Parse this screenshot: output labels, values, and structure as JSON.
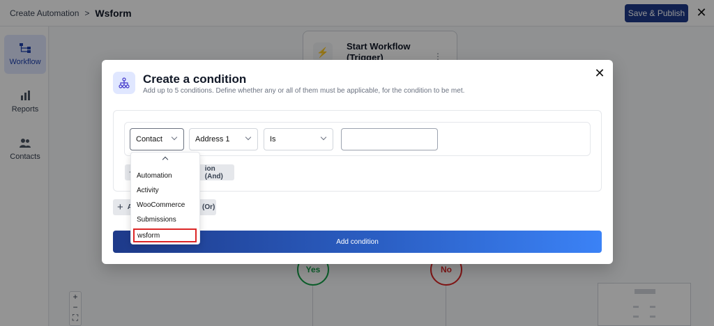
{
  "app": {
    "breadcrumb_root": "Create Automation",
    "breadcrumb_separator": ">",
    "breadcrumb_current": "Wsform",
    "save_publish_label": "Save & Publish",
    "close_glyph": "✕"
  },
  "sidebar": {
    "items": [
      {
        "label": "Workflow",
        "icon": "workflow-icon",
        "active": true
      },
      {
        "label": "Reports",
        "icon": "bar-chart-icon",
        "active": false
      },
      {
        "label": "Contacts",
        "icon": "users-icon",
        "active": false
      }
    ]
  },
  "canvas": {
    "trigger_title": "Start Workflow (Trigger)",
    "trigger_menu_glyph": "⋮",
    "branch_yes": "Yes",
    "branch_no": "No",
    "zoom_in": "+",
    "zoom_out": "−",
    "fit_glyph": "⛶"
  },
  "modal": {
    "title": "Create a condition",
    "subtitle": "Add up to 5 conditions. Define whether any or all of them must be applicable, for the condition to be met.",
    "close_glyph": "✕",
    "condition": {
      "category": "Contact",
      "field": "Address 1",
      "operator": "Is",
      "value": ""
    },
    "add_and_label": "ion (And)",
    "add_or_label_prefix": "A",
    "add_or_label": "(Or)",
    "add_condition_label": "Add condition"
  },
  "dropdown": {
    "options": [
      "Automation",
      "Activity",
      "WooCommerce",
      "Submissions",
      "wsform"
    ],
    "highlighted": "wsform"
  },
  "colors": {
    "primary": "#1e3a8a",
    "accent": "#3b82f6",
    "highlight_border": "#dc2626",
    "yes": "#16a34a",
    "no": "#dc2626"
  }
}
